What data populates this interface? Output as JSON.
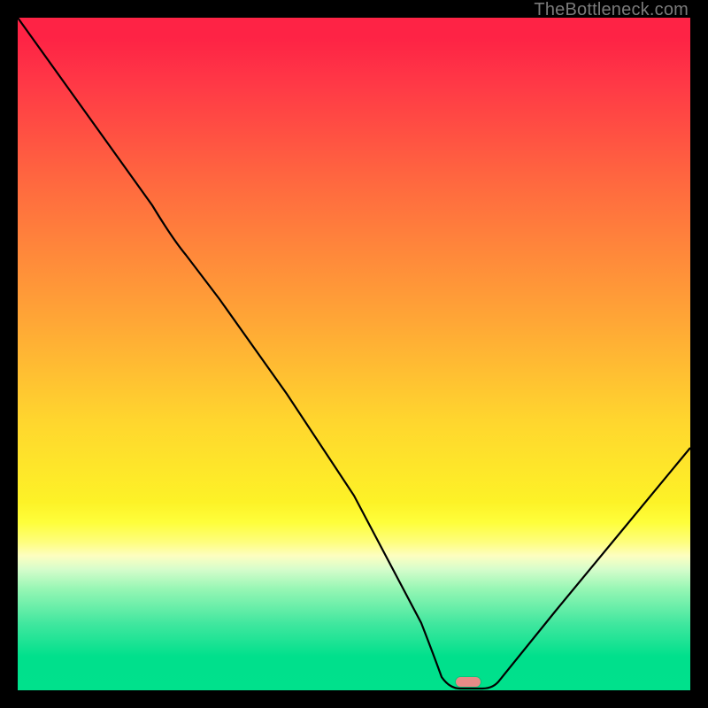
{
  "watermark": "TheBottleneck.com",
  "marker": {
    "color": "#e58b87",
    "x_frac": 0.67,
    "y_frac": 0.988
  },
  "chart_data": {
    "type": "line",
    "title": "",
    "xlabel": "",
    "ylabel": "",
    "xlim": [
      0,
      1
    ],
    "ylim": [
      0,
      1
    ],
    "series": [
      {
        "name": "bottleneck-curve",
        "x": [
          0.0,
          0.1,
          0.2,
          0.25,
          0.3,
          0.4,
          0.5,
          0.6,
          0.63,
          0.67,
          0.71,
          0.8,
          0.9,
          1.0
        ],
        "y": [
          1.0,
          0.86,
          0.72,
          0.66,
          0.59,
          0.44,
          0.29,
          0.1,
          0.02,
          0.01,
          0.02,
          0.12,
          0.24,
          0.36
        ]
      }
    ],
    "annotations": [
      {
        "type": "marker",
        "x": 0.67,
        "y": 0.01,
        "label": "optimal-point"
      }
    ],
    "background_gradient": [
      {
        "stop": 0.0,
        "color": "#fe2345"
      },
      {
        "stop": 0.45,
        "color": "#ffa636"
      },
      {
        "stop": 0.72,
        "color": "#fdf227"
      },
      {
        "stop": 1.0,
        "color": "#00e18c"
      }
    ]
  }
}
